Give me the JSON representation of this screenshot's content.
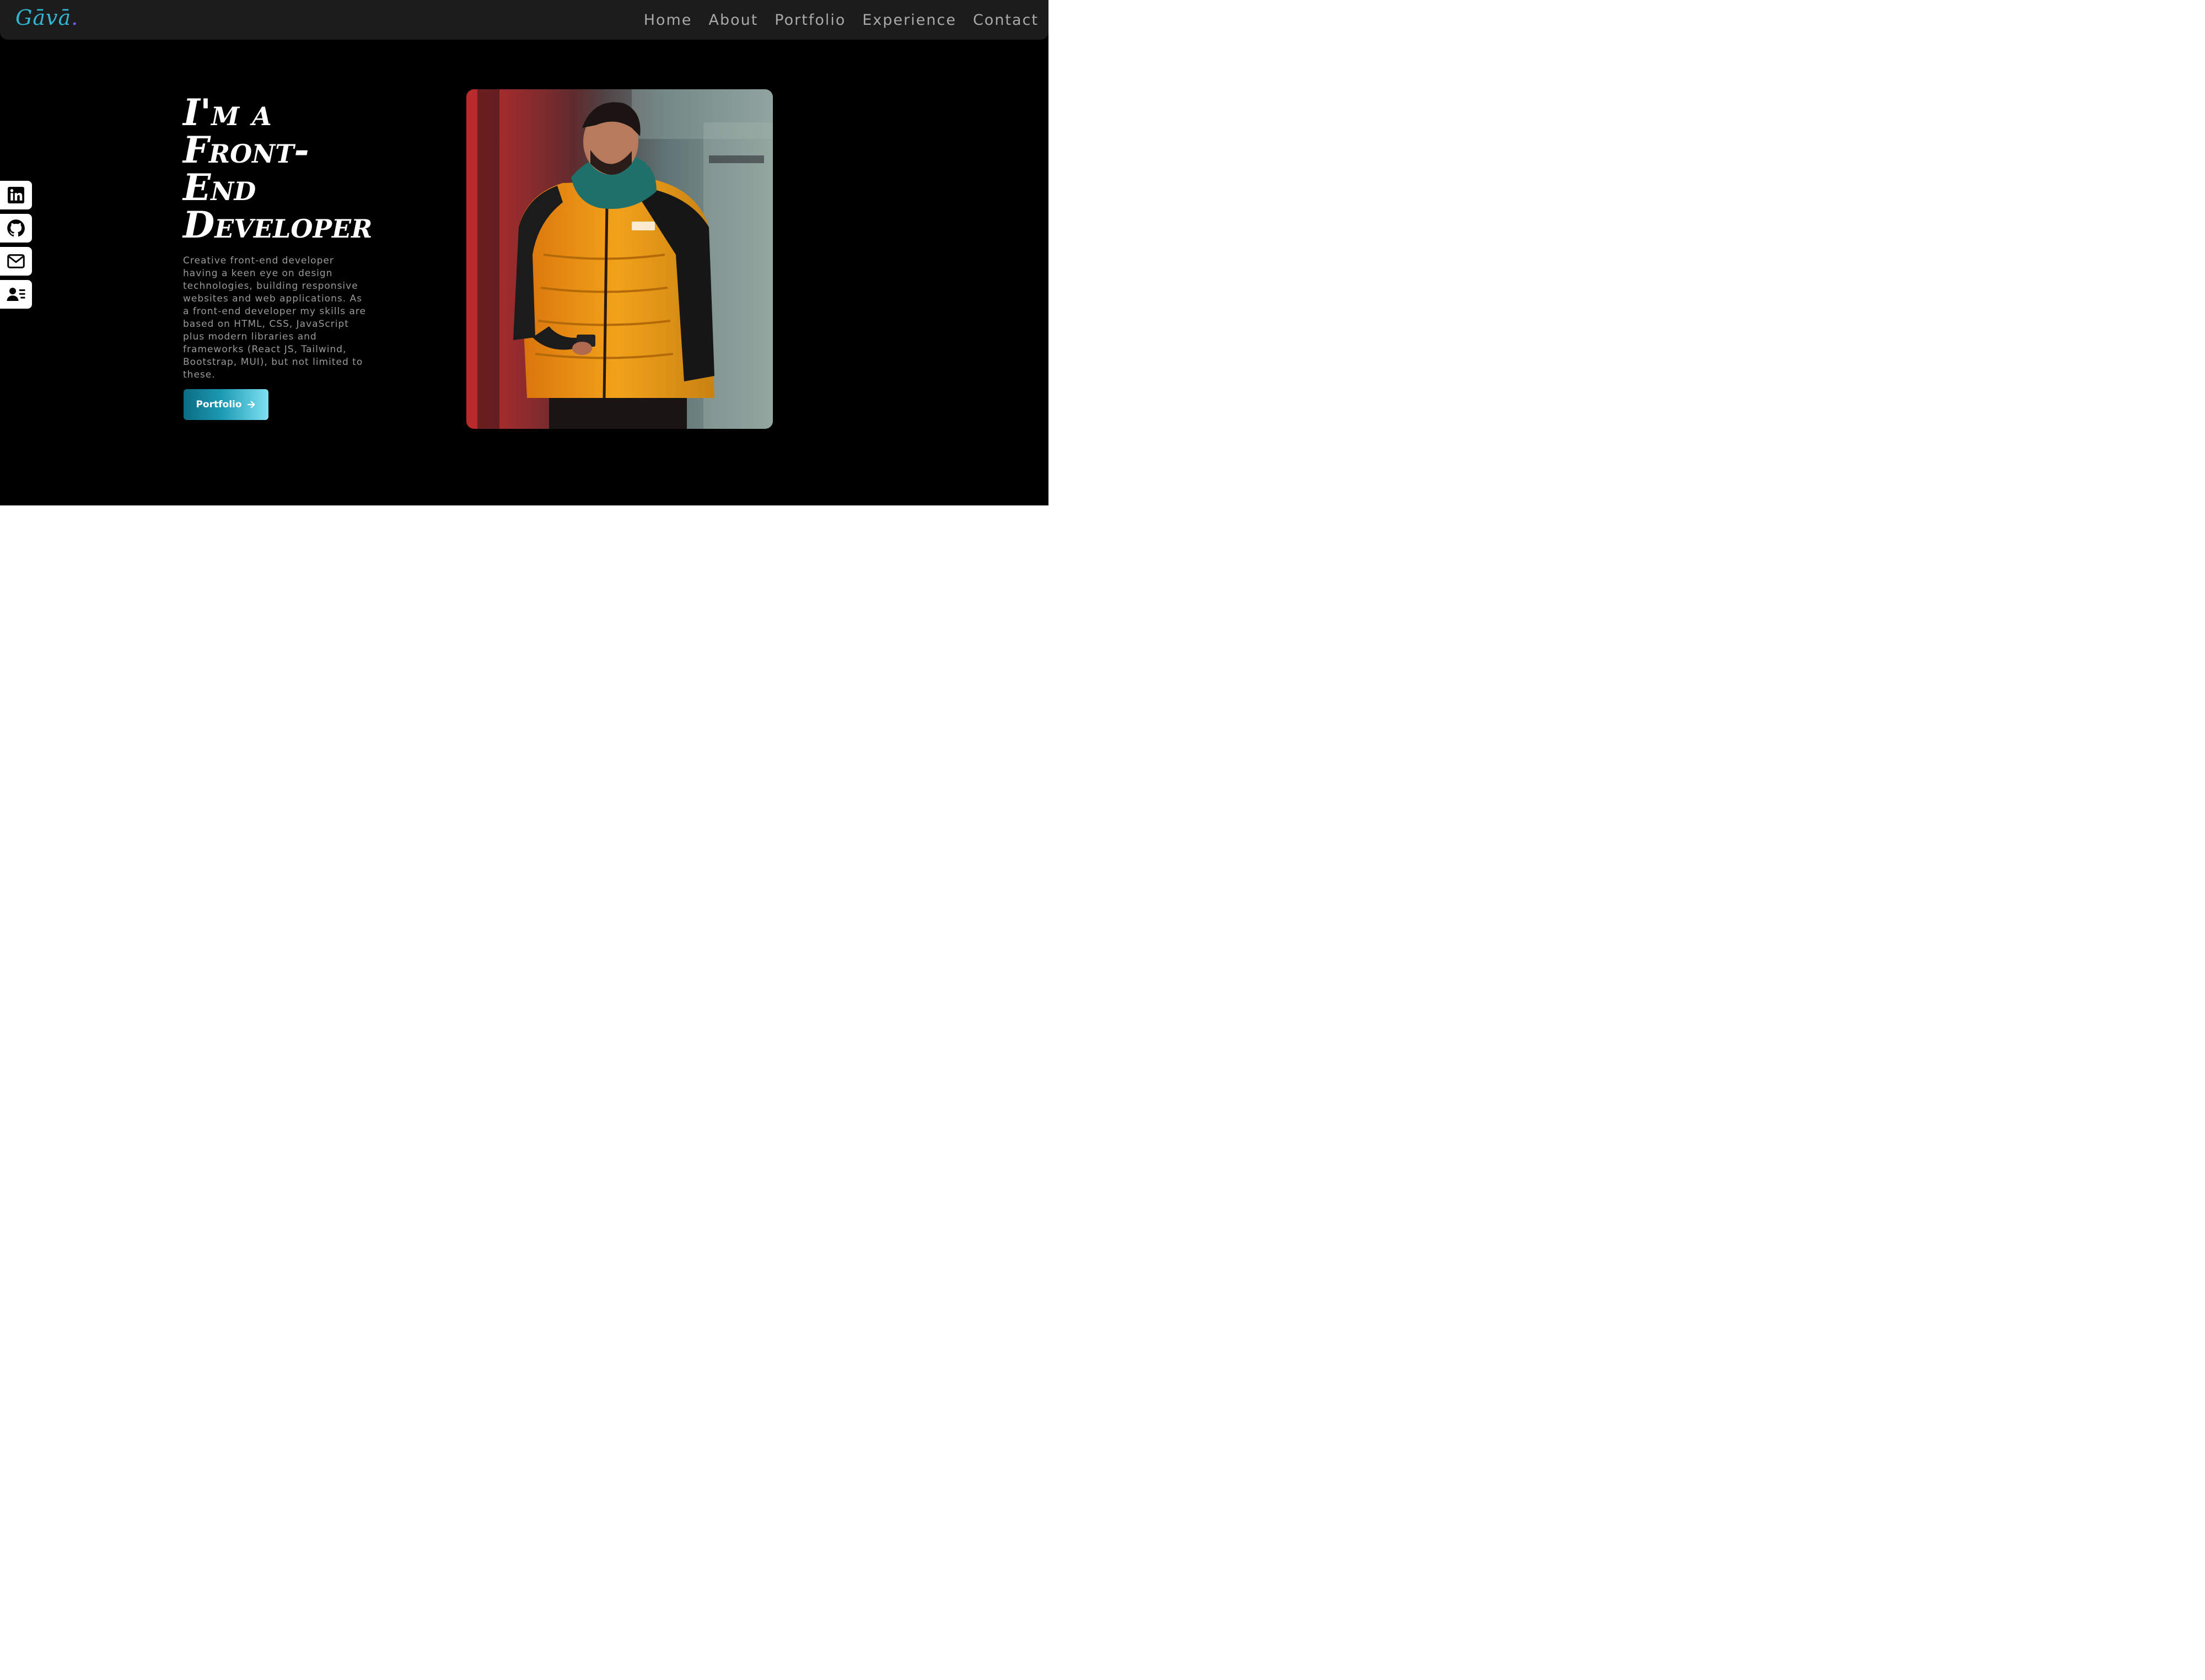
{
  "nav": {
    "logo": "Gāvā",
    "logo_dot": ".",
    "links": [
      "Home",
      "About",
      "Portfolio",
      "Experience",
      "Contact"
    ]
  },
  "social": [
    {
      "icon": "linkedin-icon"
    },
    {
      "icon": "github-icon"
    },
    {
      "icon": "mail-icon"
    },
    {
      "icon": "resume-icon"
    }
  ],
  "hero": {
    "title_lines": [
      "I'm a",
      "Front-",
      "End",
      "Developer"
    ],
    "description": "Creative front-end developer having a keen eye on design technologies, building responsive websites and web applications. As a front-end developer my skills are based on HTML, CSS, JavaScript plus modern libraries and frameworks (React JS, Tailwind, Bootstrap, MUI), but not limited to these.",
    "cta_label": "Portfolio",
    "cta_icon": "arrow-right-icon",
    "photo": "portrait-photo"
  },
  "colors": {
    "background": "#000000",
    "navbar": "#1c1c1c",
    "accent": "#2fb7d3",
    "nav_text": "#a9a9a9"
  }
}
